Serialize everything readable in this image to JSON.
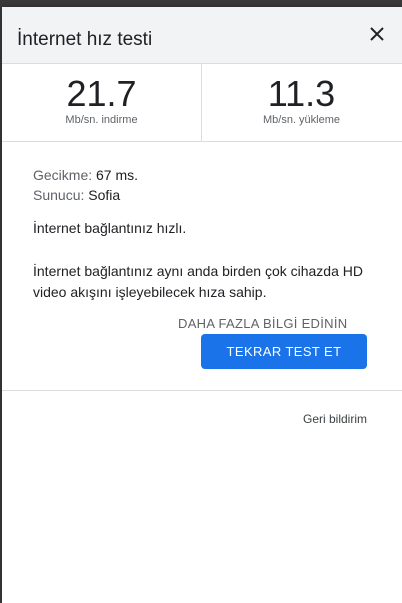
{
  "dialog": {
    "title": "İnternet hız testi",
    "close_icon": "close-icon"
  },
  "results": {
    "download": {
      "value": "21.7",
      "unit": "Mb/sn. indirme"
    },
    "upload": {
      "value": "11.3",
      "unit": "Mb/sn. yükleme"
    }
  },
  "details": {
    "latency_label": "Gecikme:",
    "latency_value": "67 ms.",
    "server_label": "Sunucu:",
    "server_value": "Sofia",
    "summary": "İnternet bağlantınız hızlı.",
    "description": "İnternet bağlantınız aynı anda birden çok cihazda HD video akışını işleyebilecek hıza sahip."
  },
  "actions": {
    "learn_more": "DAHA FAZLA BİLGİ EDİNİN",
    "retest": "TEKRAR TEST ET",
    "feedback": "Geri bildirim"
  },
  "colors": {
    "accent": "#1a73e8"
  }
}
